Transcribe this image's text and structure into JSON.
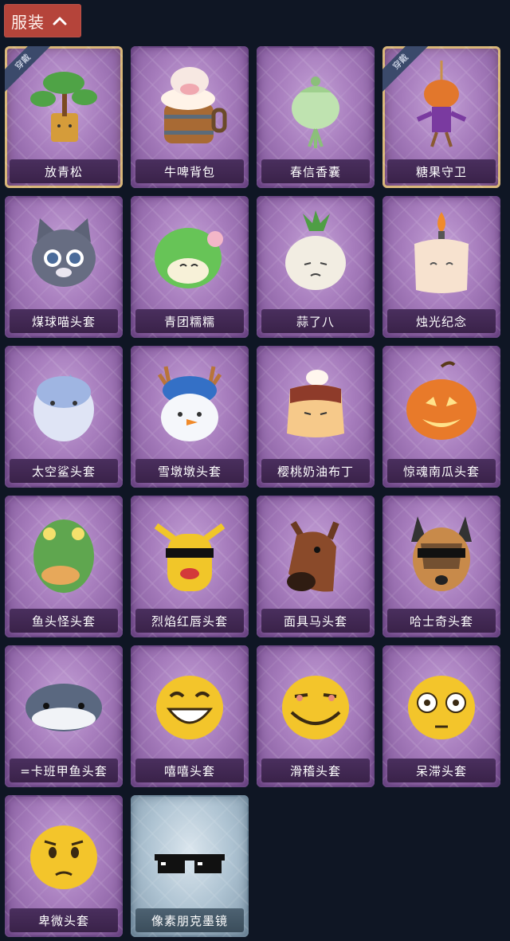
{
  "header": {
    "title": "服装",
    "chevron": "chevron-up-icon"
  },
  "items": [
    {
      "name": "放青松",
      "icon": "bonsai-pine-icon",
      "equipped": true,
      "equip_label": "穿戴",
      "theme": "purple"
    },
    {
      "name": "牛啤背包",
      "icon": "cow-beer-barrel-icon",
      "equipped": false,
      "theme": "purple"
    },
    {
      "name": "春信香囊",
      "icon": "scent-pouch-icon",
      "equipped": false,
      "theme": "purple"
    },
    {
      "name": "糖果守卫",
      "icon": "pumpkin-scarecrow-icon",
      "equipped": true,
      "equip_label": "穿戴",
      "theme": "purple"
    },
    {
      "name": "煤球喵头套",
      "icon": "gray-cat-head-icon",
      "equipped": false,
      "theme": "purple"
    },
    {
      "name": "青团糯糯",
      "icon": "green-dumpling-icon",
      "equipped": false,
      "theme": "purple"
    },
    {
      "name": "蒜了八",
      "icon": "garlic-head-icon",
      "equipped": false,
      "theme": "purple"
    },
    {
      "name": "烛光纪念",
      "icon": "candle-head-icon",
      "equipped": false,
      "theme": "purple"
    },
    {
      "name": "太空鲨头套",
      "icon": "shark-head-icon",
      "equipped": false,
      "theme": "purple"
    },
    {
      "name": "雪墩墩头套",
      "icon": "snowman-head-icon",
      "equipped": false,
      "theme": "purple"
    },
    {
      "name": "樱桃奶油布丁",
      "icon": "pudding-head-icon",
      "equipped": false,
      "theme": "purple"
    },
    {
      "name": "惊魂南瓜头套",
      "icon": "jack-o-lantern-icon",
      "equipped": false,
      "theme": "purple"
    },
    {
      "name": "鱼头怪头套",
      "icon": "fish-head-icon",
      "equipped": false,
      "theme": "purple"
    },
    {
      "name": "烈焰红唇头套",
      "icon": "yellow-mask-sunglasses-icon",
      "equipped": false,
      "theme": "purple"
    },
    {
      "name": "面具马头套",
      "icon": "horse-mask-icon",
      "equipped": false,
      "theme": "purple"
    },
    {
      "name": "哈士奇头套",
      "icon": "husky-sunglasses-icon",
      "equipped": false,
      "theme": "purple"
    },
    {
      "name": "卡班甲鱼头套",
      "display_name": "=卡班甲鱼头套",
      "icon": "whale-head-icon",
      "equipped": false,
      "theme": "purple"
    },
    {
      "name": "嘻嘻头套",
      "icon": "grin-emoji-icon",
      "equipped": false,
      "theme": "purple"
    },
    {
      "name": "滑稽头套",
      "icon": "smirk-emoji-icon",
      "equipped": false,
      "theme": "purple"
    },
    {
      "name": "呆滞头套",
      "icon": "dazed-emoji-icon",
      "equipped": false,
      "theme": "purple"
    },
    {
      "name": "卑微头套",
      "icon": "pleading-emoji-icon",
      "equipped": false,
      "theme": "purple"
    },
    {
      "name": "像素朋克墨镜",
      "icon": "pixel-sunglasses-icon",
      "equipped": false,
      "theme": "blue"
    }
  ],
  "colors": {
    "background": "#0f1624",
    "header": "#b5443a",
    "card_purple": "#a77dbd",
    "card_blue": "#aec3d2",
    "equipped_border": "#d9b779"
  }
}
